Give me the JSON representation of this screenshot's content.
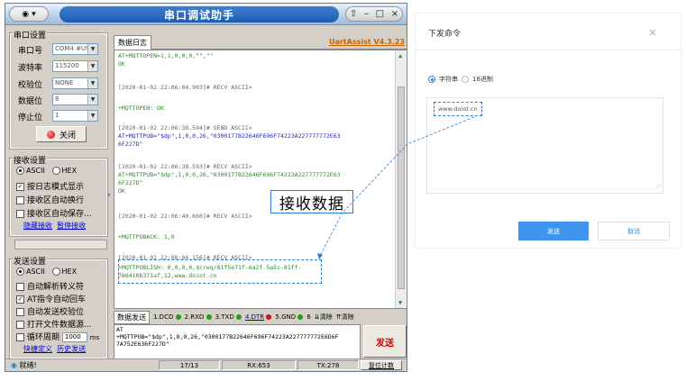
{
  "app": {
    "title": "串口调试助手",
    "version": "UartAssist V4.3.23",
    "log_tab": "数据日志"
  },
  "serial_settings": {
    "group": "串口设置",
    "port_label": "串口号",
    "port_value": "COM4 #USB",
    "baud_label": "波特率",
    "baud_value": "115200",
    "parity_label": "校验位",
    "parity_value": "NONE",
    "databits_label": "数据位",
    "databits_value": "8",
    "stopbits_label": "停止位",
    "stopbits_value": "1",
    "close_button": "关闭"
  },
  "receive_settings": {
    "group": "接收设置",
    "ascii": "ASCII",
    "hex": "HEX",
    "opt1": "按日志模式显示",
    "opt2": "接收区自动换行",
    "opt3": "接收区自动保存...",
    "link1": "隐藏接收",
    "link2": "暂停接收"
  },
  "send_settings": {
    "group": "发送设置",
    "ascii": "ASCII",
    "hex": "HEX",
    "opt1": "自动解析转义符",
    "opt2": "AT指令自动回车",
    "opt3": "自动发送校验位",
    "opt4": "打开文件数据源...",
    "loop_label": "循环周期",
    "loop_value": "1000",
    "loop_unit": "ms",
    "link1": "快捷定义",
    "link2": "历史发送"
  },
  "log_lines": {
    "l1": "AT+MQTTOPEN=1,1,0,0,0,\"\",\"\"",
    "l2": "OK",
    "l3": "[2020-01-02 22:06:04.903]# RECV ASCII>",
    "l4": "+MQTTOPEN: OK",
    "l5": "[2020-01-02 22:06:38.504]# SEND ASCII>",
    "l6": "AT+MQTTPUB=\"$dp\",1,0,0,26,\"0300177B22646F696F74223A227777772E63",
    "l7": "6F227D\"",
    "l8": "[2020-01-02 22:06:38.593]# RECV ASCII>",
    "l9": "AT+MQTTPUB=\"$dp\",1,0,0,26,\"0300177B22646F696F74223A227777772E63",
    "l10": "6F227D\"",
    "l11": "OK",
    "l12": "[2020-01-02 22:06:40.660]# RECV ASCII>",
    "l13": "+MQTTPUBACK: 1,0",
    "l14": "[2020-01-02 22:08:04.156]# RECV ASCII>",
    "l15": "+MQTTPUBLISH: 0,0,0,0,$creq/81f5e71f-6a2f-5a5c-81ff-",
    "l16": "786410b371af,12,www.doiot.cn"
  },
  "callout": "接收数据",
  "send_bar": {
    "tab": "数据发送",
    "dcd": "1.DCD",
    "rxd": "2.RXD",
    "txd": "3.TXD",
    "dtr": "4.DTR",
    "gnd": "5.GND",
    "six": "6",
    "clear1": "清除",
    "clear2": "清除"
  },
  "send_text": {
    "line1": "AT",
    "line2": "+MQTTPUB=\"$dp\",1,0,0,26,\"0300177B22646F696F74223A227777772E6D6F",
    "line3": "7A752E636F227D\""
  },
  "send_button": "发送",
  "status": {
    "ready": "就绪!",
    "count": "17/13",
    "rx": "RX:653",
    "tx": "TX:278",
    "reset": "复位计数"
  },
  "dialog": {
    "title": "下发命令",
    "close": "×",
    "radio1": "字符串",
    "radio2": "16进制",
    "url": "www.doiot.cn",
    "ok": "发送",
    "cancel": "取消"
  },
  "colors": {
    "accent": "#2a7ad6",
    "primary_button": "#3d95f0",
    "log_text": "#2c8a2c",
    "send_text": "#2a2ab0"
  }
}
